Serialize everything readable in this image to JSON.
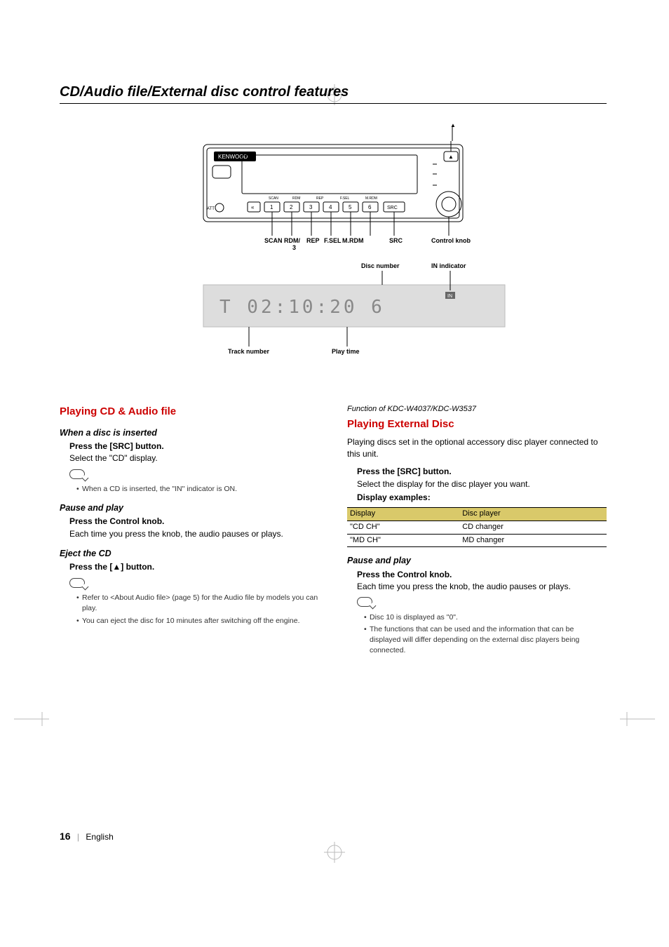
{
  "page": {
    "section_title": "CD/Audio file/External disc control features",
    "footer_page": "16",
    "footer_lang": "English"
  },
  "diagram": {
    "eject_glyph": "▲",
    "button_labels": [
      "SCAN",
      "RDM",
      "REP",
      "F.SEL",
      "M.RDM"
    ],
    "preset_numbers": [
      "1",
      "2",
      "3",
      "4",
      "5",
      "6"
    ],
    "src_btn": "SRC",
    "callouts": {
      "scan": "SCAN",
      "rdm": "RDM/",
      "rdm_sub": "3",
      "rep": "REP",
      "fsel": "F.SEL",
      "mrdm": "M.RDM",
      "src": "SRC",
      "control_knob": "Control knob",
      "disc_number": "Disc number",
      "in_indicator": "IN indicator",
      "track_number": "Track number",
      "play_time": "Play time"
    },
    "lcd_sample": "T     0 2 : 1 0 : 2 0   6"
  },
  "left": {
    "h1": "Playing CD & Audio file",
    "sub1": "When a disc is inserted",
    "instr1": "Press the [SRC] button.",
    "body1": "Select the \"CD\" display.",
    "note1_bullets": [
      "When a CD is inserted, the \"IN\" indicator is ON."
    ],
    "sub2": "Pause and play",
    "instr2": "Press the Control knob.",
    "body2": "Each time you press the knob, the audio pauses or plays.",
    "sub3": "Eject the CD",
    "instr3": "Press the [▲] button.",
    "note2_bullets": [
      "Refer to <About Audio file> (page 5) for the Audio file by models you can play.",
      "You can eject the disc for 10 minutes after switching off the engine."
    ]
  },
  "right": {
    "func_of": "Function of KDC-W4037/KDC-W3537",
    "h1": "Playing External Disc",
    "body0": "Playing discs set in the optional accessory disc player connected to this unit.",
    "instr1": "Press the [SRC] button.",
    "body1": "Select the display for the disc player you want.",
    "disp_examples_label": "Display examples:",
    "table": {
      "headers": [
        "Display",
        "Disc player"
      ],
      "rows": [
        [
          "\"CD CH\"",
          "CD changer"
        ],
        [
          "\"MD CH\"",
          "MD changer"
        ]
      ]
    },
    "sub2": "Pause and play",
    "instr2": "Press the Control knob.",
    "body2": "Each time you press the knob, the audio pauses or plays.",
    "note_bullets": [
      "Disc 10 is displayed as \"0\".",
      "The functions that can be used and the information that can be displayed will differ depending on the external disc players being connected."
    ]
  }
}
